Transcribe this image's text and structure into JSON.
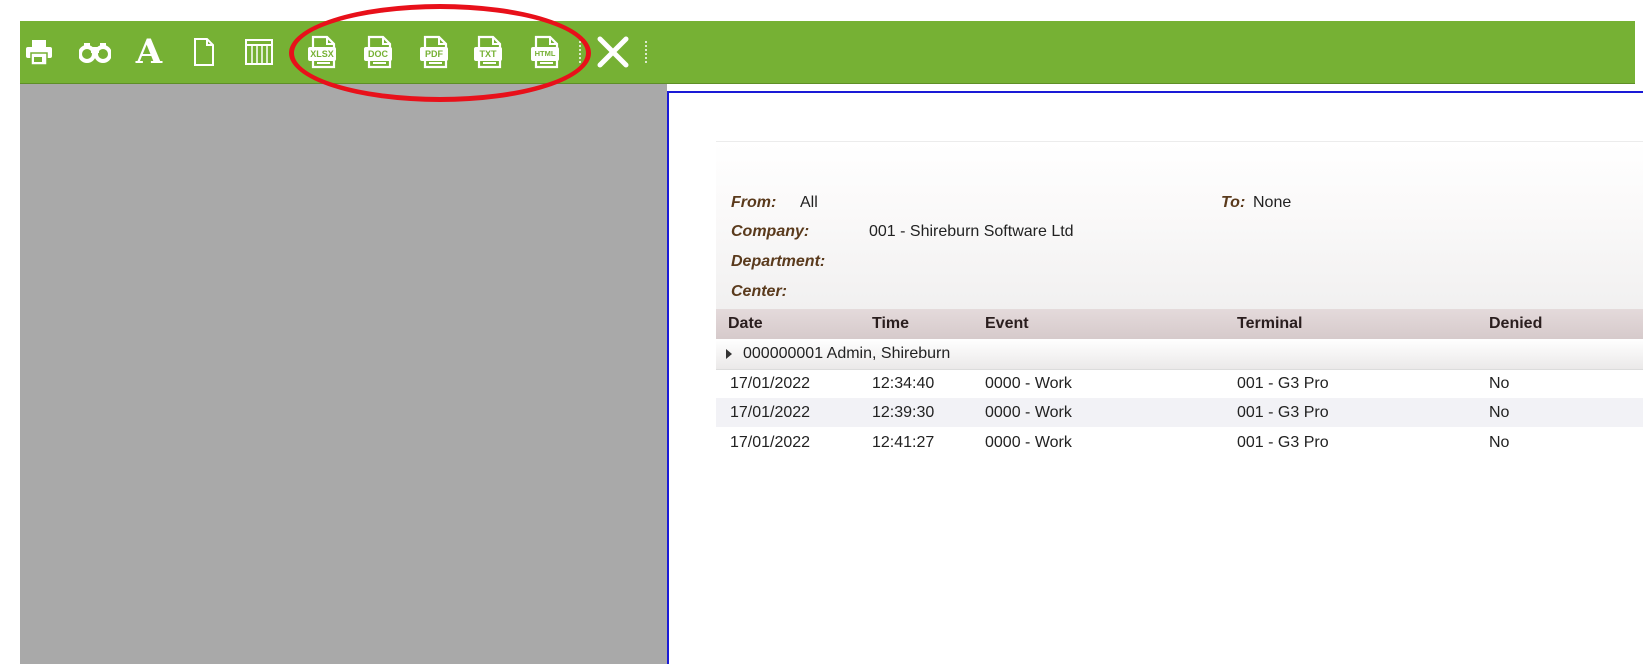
{
  "toolbar": {
    "buttons": [
      {
        "name": "print-button",
        "icon": "printer-icon"
      },
      {
        "name": "find-button",
        "icon": "binoculars-icon"
      },
      {
        "name": "font-button",
        "icon": "font-icon"
      },
      {
        "name": "page-setup-button",
        "icon": "page-icon"
      },
      {
        "name": "columns-button",
        "icon": "columns-icon"
      },
      {
        "name": "export-xlsx-button",
        "icon": "xlsx-file-icon",
        "tag": "XLSX"
      },
      {
        "name": "export-doc-button",
        "icon": "doc-file-icon",
        "tag": "DOC"
      },
      {
        "name": "export-pdf-button",
        "icon": "pdf-file-icon",
        "tag": "PDF"
      },
      {
        "name": "export-txt-button",
        "icon": "txt-file-icon",
        "tag": "TXT"
      },
      {
        "name": "export-html-button",
        "icon": "html-file-icon",
        "tag": "HTML"
      },
      {
        "name": "close-button",
        "icon": "close-icon"
      }
    ],
    "font_glyph": "A",
    "tags": {
      "xlsx": "XLSX",
      "doc": "DOC",
      "pdf": "PDF",
      "txt": "TXT",
      "html": "HTML"
    }
  },
  "colors": {
    "toolbar_bg": "#76b134",
    "annotation_circle": "#e8101a",
    "report_border": "#1a1ad6",
    "label_color": "#5a3a1c",
    "left_panel": "#a9a9a9"
  },
  "report": {
    "filters": {
      "from_label": "From:",
      "from_value": "All",
      "to_label": "To:",
      "to_value": "None",
      "company_label": "Company:",
      "company_value": "001 - Shireburn Software Ltd",
      "department_label": "Department:",
      "center_label": "Center:"
    },
    "columns": [
      "Date",
      "Time",
      "Event",
      "Terminal",
      "Denied"
    ],
    "group": {
      "label": "000000001 Admin, Shireburn"
    },
    "rows": [
      [
        "17/01/2022",
        "12:34:40",
        "0000 - Work",
        "001 - G3 Pro",
        "No"
      ],
      [
        "17/01/2022",
        "12:39:30",
        "0000 - Work",
        "001 - G3 Pro",
        "No"
      ],
      [
        "17/01/2022",
        "12:41:27",
        "0000 - Work",
        "001 - G3 Pro",
        "No"
      ]
    ]
  }
}
